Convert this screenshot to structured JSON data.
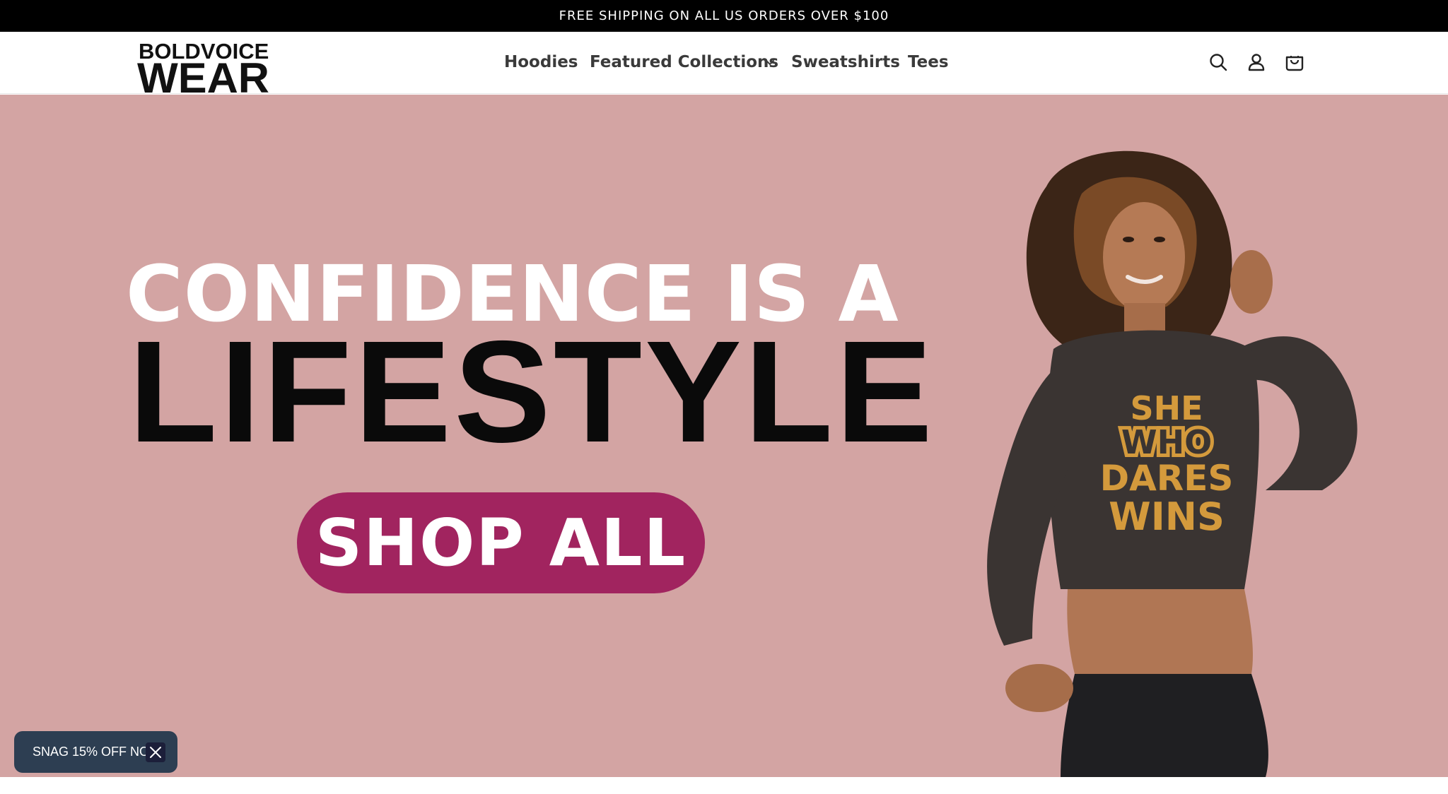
{
  "announcement": {
    "text": "FREE SHIPPING ON ALL US ORDERS OVER $100"
  },
  "header": {
    "logo": {
      "line1": "BOLDVOICE",
      "line2": "WEAR"
    },
    "nav": [
      {
        "label": "Hoodies"
      },
      {
        "label": "Featured Collections",
        "has_dropdown": true
      },
      {
        "label": "Sweatshirts"
      },
      {
        "label": "Tees"
      }
    ],
    "icons": [
      "search-icon",
      "account-icon",
      "cart-icon"
    ]
  },
  "hero": {
    "headline_line1": "CONFIDENCE IS A",
    "headline_line2": "LIFESTYLE",
    "cta_label": "SHOP ALL",
    "background_color": "#d3a4a3",
    "cta_color": "#a1245f",
    "shirt_text": [
      "SHE",
      "WHO",
      "DARES",
      "WINS"
    ]
  },
  "promo": {
    "label": "SNAG 15% OFF NOW!"
  }
}
